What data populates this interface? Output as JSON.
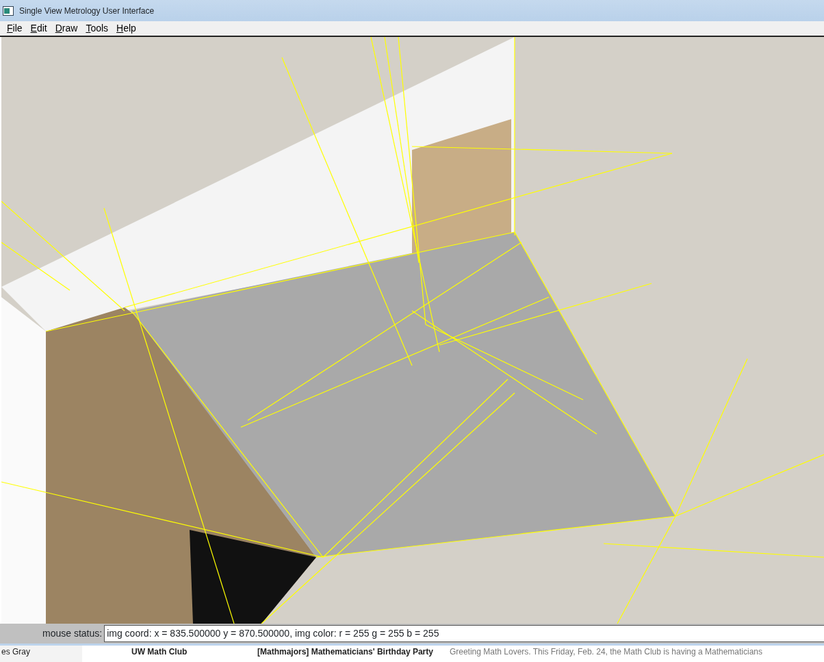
{
  "window": {
    "title": "Single View Metrology User Interface"
  },
  "menu": [
    {
      "label": "File"
    },
    {
      "label": "Edit"
    },
    {
      "label": "Draw"
    },
    {
      "label": "Tools"
    },
    {
      "label": "Help"
    }
  ],
  "status_bar": {
    "label": "mouse status:",
    "value": "img coord: x = 835.500000 y = 870.500000, img color: r = 255 g = 255 b = 255"
  },
  "background_window": {
    "sidebar_item": "es Gray",
    "sender": "UW Math Club",
    "subject": "[Mathmajors] Mathematicians' Birthday Party",
    "snippet": "Greeting Math Lovers. This Friday, Feb. 24, the Math Club is having a Mathematicians"
  }
}
